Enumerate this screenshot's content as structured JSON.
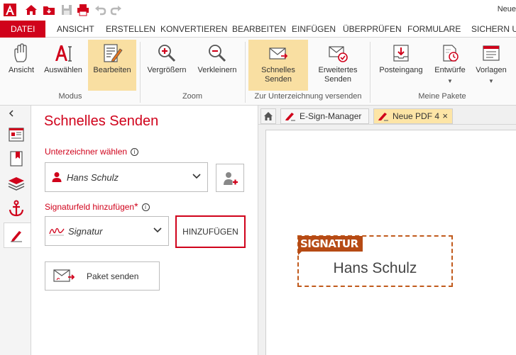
{
  "window": {
    "doc_title": "Neue"
  },
  "menu": {
    "items": [
      {
        "label": "DATEI",
        "active": true
      },
      {
        "label": "ANSICHT"
      },
      {
        "label": "ERSTELLEN"
      },
      {
        "label": "KONVERTIEREN"
      },
      {
        "label": "BEARBEITEN"
      },
      {
        "label": "EINFÜGEN"
      },
      {
        "label": "ÜBERPRÜFEN"
      },
      {
        "label": "FORMULARE"
      },
      {
        "label": "SICHERN UN"
      }
    ]
  },
  "ribbon": {
    "buttons": [
      {
        "label": "Ansicht",
        "icon": "hand-icon"
      },
      {
        "label": "Auswählen",
        "icon": "text-select-icon"
      },
      {
        "label": "Bearbeiten",
        "icon": "edit-document-icon",
        "selected": true
      },
      {
        "label": "Vergrößern",
        "icon": "zoom-in-icon"
      },
      {
        "label": "Verkleinern",
        "icon": "zoom-out-icon"
      },
      {
        "label": "Schnelles Senden",
        "label2": "Senden",
        "label1": "Schnelles",
        "icon": "quick-send-icon",
        "selected": true
      },
      {
        "label1": "Erweitertes",
        "label2": "Senden",
        "icon": "advanced-send-icon"
      },
      {
        "label": "Posteingang",
        "icon": "inbox-icon"
      },
      {
        "label": "Entwürfe",
        "icon": "drafts-icon"
      },
      {
        "label": "Vorlagen",
        "icon": "templates-icon"
      }
    ],
    "groups": {
      "modus": "Modus",
      "zoom": "Zoom",
      "send": "Zur Unterzeichnung versenden",
      "packages": "Meine Pakete"
    }
  },
  "panel": {
    "title": "Schnelles Senden",
    "signer_label": "Unterzeichner wählen",
    "signer_value": "Hans Schulz",
    "sigfield_label": "Signaturfeld hinzufügen",
    "sigfield_required": "*",
    "sigfield_value": "Signatur",
    "add_button": "HINZUFÜGEN",
    "send_package_button": "Paket senden"
  },
  "tabs": [
    {
      "label": "E-Sign-Manager"
    },
    {
      "label": "Neue PDF 4",
      "active": true,
      "close": "×"
    }
  ],
  "document": {
    "sig_tag": "SIGNATUR",
    "sig_name": "Hans Schulz"
  },
  "colors": {
    "accent": "#d0021b",
    "selected": "#f9dfa2",
    "signature_field": "#b64a14"
  }
}
